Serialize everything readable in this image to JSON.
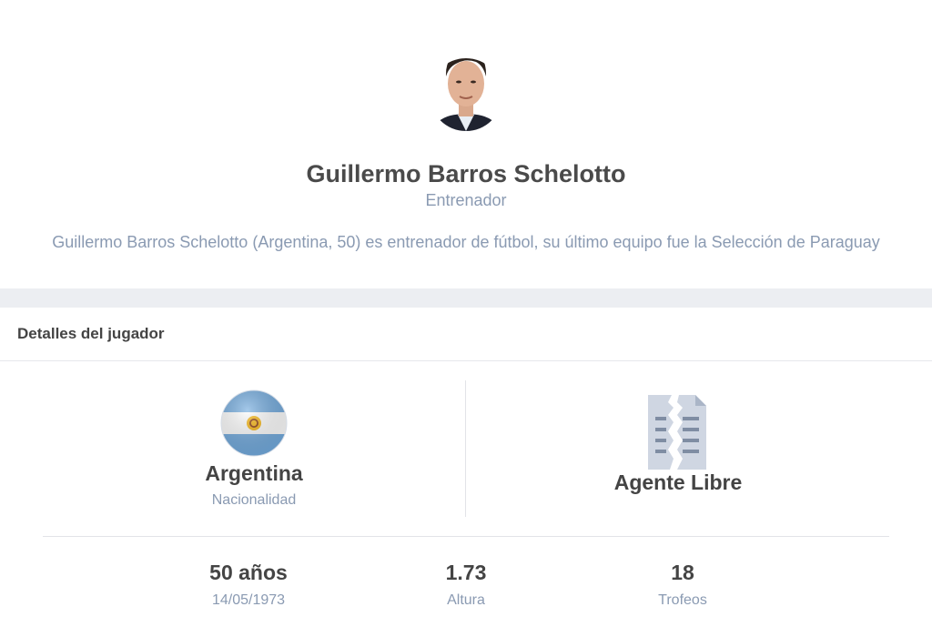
{
  "profile": {
    "name": "Guillermo Barros Schelotto",
    "role": "Entrenador",
    "bio": "Guillermo Barros Schelotto (Argentina, 50) es entrenador de fútbol, su último equipo fue la Selección de Paraguay"
  },
  "details": {
    "title": "Detalles del jugador",
    "nationality": {
      "value": "Argentina",
      "label": "Nacionalidad",
      "flag_icon": "argentina-flag-icon"
    },
    "contract": {
      "value": "Agente Libre",
      "icon": "contract-document-icon"
    },
    "stats": [
      {
        "value": "50 años",
        "label": "14/05/1973"
      },
      {
        "value": "1.73",
        "label": "Altura"
      },
      {
        "value": "18",
        "label": "Trofeos"
      }
    ]
  },
  "colors": {
    "text_dark": "#444444",
    "text_muted": "#8a9ab2",
    "flag_blue": "#74acdf",
    "divider": "#eceef2"
  }
}
